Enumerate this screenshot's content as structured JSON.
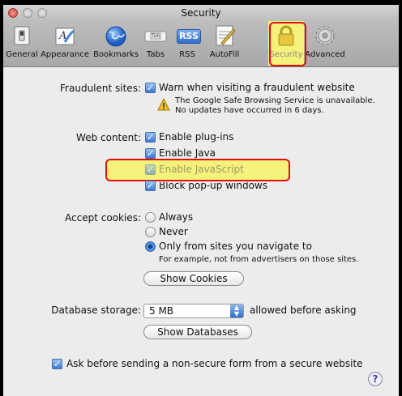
{
  "window": {
    "title": "Security"
  },
  "toolbar": {
    "items": [
      {
        "label": "General",
        "icon": "light-switch-icon"
      },
      {
        "label": "Appearance",
        "icon": "font-icon"
      },
      {
        "label": "Bookmarks",
        "icon": "globe-icon"
      },
      {
        "label": "Tabs",
        "icon": "tabs-icon"
      },
      {
        "label": "RSS",
        "icon": "rss-icon"
      },
      {
        "label": "AutoFill",
        "icon": "pencil-form-icon"
      },
      {
        "label": "Security",
        "icon": "padlock-icon"
      },
      {
        "label": "Advanced",
        "icon": "gear-icon"
      }
    ],
    "rss_badge": "RSS",
    "tabs_badge": "Tab",
    "selected": "Security"
  },
  "fraud": {
    "label": "Fraudulent sites:",
    "checkbox": "Warn when visiting a fraudulent website",
    "notice_line1": "The Google Safe Browsing Service is unavailable.",
    "notice_line2": "No updates have occurred in 6 days."
  },
  "web_content": {
    "label": "Web content:",
    "plugins": "Enable plug-ins",
    "java": "Enable Java",
    "javascript": "Enable JavaScript",
    "popups": "Block pop-up windows"
  },
  "cookies": {
    "label": "Accept cookies:",
    "always": "Always",
    "never": "Never",
    "only_from": "Only from sites you navigate to",
    "hint": "For example, not from advertisers on those sites.",
    "show_button": "Show Cookies"
  },
  "database": {
    "label": "Database storage:",
    "value": "5 MB",
    "suffix": "allowed before asking",
    "show_button": "Show Databases"
  },
  "nonsecure": {
    "checkbox": "Ask before sending a non-secure form from a secure website"
  },
  "help": {
    "glyph": "?"
  },
  "colors": {
    "highlight_yellow": "#f4f27a",
    "highlight_border": "#e01010",
    "checkbox_blue": "#3a78d6"
  }
}
